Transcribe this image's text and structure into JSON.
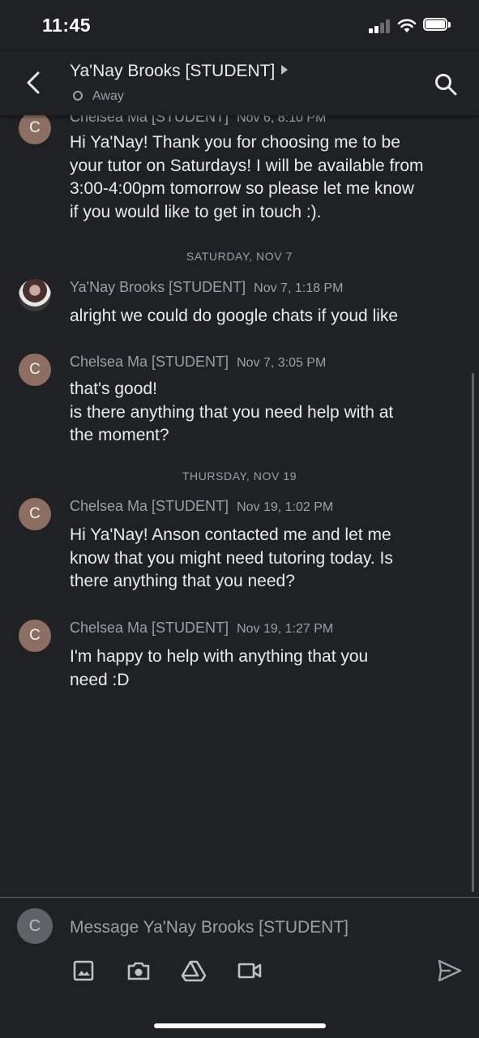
{
  "status_bar": {
    "time": "11:45"
  },
  "header": {
    "title": "Ya'Nay Brooks [STUDENT]",
    "presence": "Away"
  },
  "messages": [
    {
      "avatar": "C",
      "sender": "Chelsea Ma [STUDENT]",
      "time": "Nov 6, 8:10 PM",
      "lines": [
        "Hi Ya'Nay! Thank you for choosing me to be",
        "your tutor on Saturdays! I will be available from",
        "3:00-4:00pm tomorrow so please let me know",
        "if you would like to get in touch :)."
      ]
    },
    {
      "divider": "SATURDAY, NOV 7"
    },
    {
      "avatar": "",
      "sender": "Ya'Nay Brooks [STUDENT]",
      "time": "Nov 7, 1:18 PM",
      "lines": [
        "alright we could do google chats if youd like"
      ]
    },
    {
      "avatar": "C",
      "sender": "Chelsea Ma [STUDENT]",
      "time": "Nov 7, 3:05 PM",
      "lines": [
        "that's good!",
        "is there anything that you need help with at",
        "the moment?"
      ]
    },
    {
      "divider": "THURSDAY, NOV 19"
    },
    {
      "avatar": "C",
      "sender": "Chelsea Ma [STUDENT]",
      "time": "Nov 19, 1:02 PM",
      "lines": [
        "Hi Ya'Nay! Anson contacted me and let me",
        "know that you might need tutoring today. Is",
        "there anything that you need?"
      ]
    },
    {
      "avatar": "C",
      "sender": "Chelsea Ma [STUDENT]",
      "time": "Nov 19, 1:27 PM",
      "lines": [
        "I'm happy to help with anything that you",
        "need :D"
      ]
    }
  ],
  "composer": {
    "avatar": "C",
    "placeholder": "Message Ya'Nay Brooks [STUDENT]",
    "tools": [
      "image-icon",
      "camera-icon",
      "drive-icon",
      "video-icon"
    ],
    "send_icon": "send-icon"
  },
  "colors": {
    "background": "#202124",
    "avatar": "#8d6e63",
    "text": "#e8eaed",
    "muted": "#9aa0a6"
  }
}
